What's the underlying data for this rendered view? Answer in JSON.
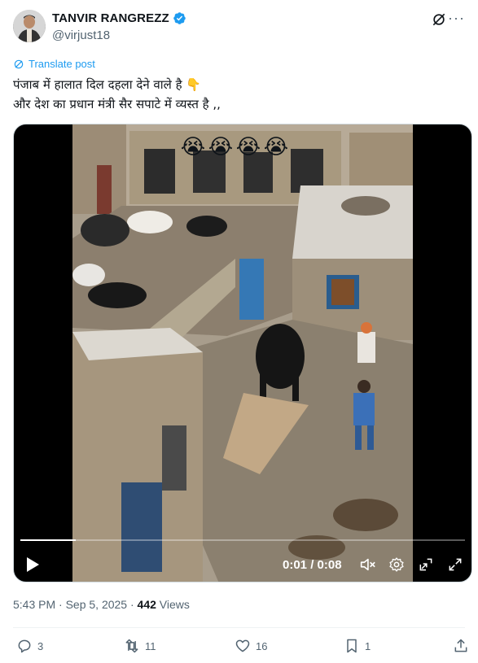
{
  "author": {
    "name": "TANVIR RANGREZZ",
    "handle": "@virjust18"
  },
  "translate_label": "Translate post",
  "tweet_lines": [
    "पंजाब में हालात दिल दहला देने वाले है 👇",
    "और देश का प्रधान मंत्री सैर सपाटे में व्यस्त है ,,"
  ],
  "video": {
    "overlay_emojis": [
      "😭",
      "😭",
      "😭",
      "😭"
    ],
    "time": "0:01 / 0:08",
    "progress": 0.125
  },
  "meta": {
    "timestamp": "5:43 PM · Sep 5, 2025 · ",
    "views_count": "442",
    "views_label": " Views"
  },
  "actions": {
    "replies": "3",
    "retweets": "11",
    "likes": "16",
    "bookmarks": "1"
  },
  "colors": {
    "accent": "#1d9bf0",
    "secondary_text": "#536471"
  }
}
